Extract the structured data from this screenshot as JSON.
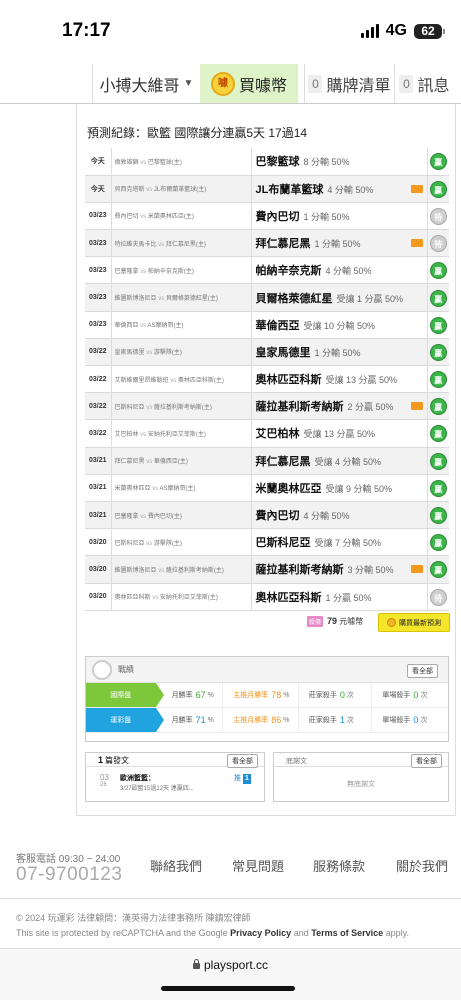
{
  "status_bar": {
    "time": "17:17",
    "network": "4G",
    "battery": "62"
  },
  "nav": {
    "user": "小搏大維哥",
    "buy_coin_icon": "coin-icon",
    "buy_label": "買噱幣",
    "list_count": "0",
    "list_label": "購牌清單",
    "msg_count": "0",
    "msg_label": "訊息"
  },
  "prediction": {
    "title": "預測紀錄：歐籃  國際讓分連贏5天 17過14",
    "rows": [
      {
        "date": "今天",
        "home": "倫敦雄獅",
        "away": "巴黎籃球",
        "team": "巴黎籃球",
        "detail": "8 分輸 50%",
        "star": false,
        "status": "贏"
      },
      {
        "date": "今天",
        "home": "貝西克塔斯",
        "away": "JL布爾蘭革籃球",
        "team": "JL布蘭革籃球",
        "detail": "4 分輸 50%",
        "star": true,
        "status": "贏"
      },
      {
        "date": "03/23",
        "home": "費內巴切",
        "away": "米蘭奧林匹亞",
        "team": "費內巴切",
        "detail": "1 分輸 50%",
        "star": false,
        "status": "待"
      },
      {
        "date": "03/23",
        "home": "特拉維夫馬卡比",
        "away": "拜仁慕尼黑",
        "team": "拜仁慕尼黑",
        "detail": "1 分輸 50%",
        "star": true,
        "status": "待"
      },
      {
        "date": "03/23",
        "home": "巴塞隆拿",
        "away": "帕納辛奈克斯",
        "team": "帕納辛奈克斯",
        "detail": "4 分輸 50%",
        "star": false,
        "status": "贏"
      },
      {
        "date": "03/23",
        "home": "維圖斯博洛尼亞",
        "away": "貝爾格萊德紅星",
        "team": "貝爾格萊德紅星",
        "detail": "受讓 1 分贏 50%",
        "star": false,
        "status": "贏"
      },
      {
        "date": "03/23",
        "home": "華倫西亞",
        "away": "AS摩納哥",
        "team": "華倫西亞",
        "detail": "受讓 10 分輸 50%",
        "star": false,
        "status": "贏"
      },
      {
        "date": "03/22",
        "home": "皇家馬德里",
        "away": "游擊隊",
        "team": "皇家馬德里",
        "detail": "1 分輸 50%",
        "star": false,
        "status": "贏"
      },
      {
        "date": "03/22",
        "home": "艾斯維爾里昂維勒班",
        "away": "奧林匹亞科斯",
        "team": "奧林匹亞科斯",
        "detail": "受讓 13 分贏 50%",
        "star": false,
        "status": "贏"
      },
      {
        "date": "03/22",
        "home": "巴斯科尼亞",
        "away": "薩拉基利斯考納斯",
        "team": "薩拉基利斯考納斯",
        "detail": "2 分贏 50%",
        "star": true,
        "status": "贏"
      },
      {
        "date": "03/22",
        "home": "艾巴柏林",
        "away": "安納托利亞艾菲斯",
        "team": "艾巴柏林",
        "detail": "受讓 13 分贏 50%",
        "star": false,
        "status": "贏"
      },
      {
        "date": "03/21",
        "home": "拜仁慕尼黑",
        "away": "華倫西亞",
        "team": "拜仁慕尼黑",
        "detail": "受讓 4 分輸 50%",
        "star": false,
        "status": "贏"
      },
      {
        "date": "03/21",
        "home": "米蘭奧林匹亞",
        "away": "AS摩納哥",
        "team": "米蘭奧林匹亞",
        "detail": "受讓 9 分輸 50%",
        "star": false,
        "status": "贏"
      },
      {
        "date": "03/21",
        "home": "巴塞隆拿",
        "away": "費內巴切",
        "team": "費內巴切",
        "detail": "4 分輸 50%",
        "star": false,
        "status": "贏"
      },
      {
        "date": "03/20",
        "home": "巴斯科尼亞",
        "away": "游擊隊",
        "team": "巴斯科尼亞",
        "detail": "受讓 7 分輸 50%",
        "star": false,
        "status": "贏"
      },
      {
        "date": "03/20",
        "home": "維圖斯博洛尼亞",
        "away": "薩拉基利斯考納斯",
        "team": "薩拉基利斯考納斯",
        "detail": "3 分輸 50%",
        "star": true,
        "status": "贏"
      },
      {
        "date": "03/20",
        "home": "奧林匹亞科斯",
        "away": "安納托利亞艾菲斯",
        "team": "奧林匹亞科斯",
        "detail": "1 分贏 50%",
        "star": false,
        "status": "待"
      }
    ],
    "vs_text": "vs",
    "home_suffix": "(主)",
    "price_tag": "殺價",
    "price_value": "79",
    "price_unit": "元噱幣",
    "buy_button": "購買最新預測"
  },
  "record": {
    "title": "戰績",
    "view_all": "看全部",
    "rows": [
      {
        "label": "國際盤",
        "color": "#7dc73b",
        "rate_label": "月勝率",
        "rate": "67",
        "main_label": "主推月勝率",
        "main_rate": "78",
        "killer_label": "莊家殺手",
        "killer": "0",
        "single_label": "單場殺手",
        "single": "0",
        "unit_pct": "%",
        "unit_count": "次"
      },
      {
        "label": "運彩盤",
        "color": "#21a3e0",
        "rate_label": "月勝率",
        "rate": "71",
        "main_label": "主推月勝率",
        "main_rate": "86",
        "killer_label": "莊家殺手",
        "killer": "1",
        "single_label": "單場殺手",
        "single": "0",
        "unit_pct": "%",
        "unit_count": "次"
      }
    ]
  },
  "posts": {
    "count": "1",
    "label": "篇發文",
    "view_all": "看全部",
    "items": [
      {
        "month": "03",
        "day": "26",
        "title": "歐洲籃籃：",
        "sub": "3/27歐籃15過12天 連贏四...",
        "push_label": "推",
        "push_count": "1"
      }
    ]
  },
  "ask": {
    "label": "底謝文",
    "view_all": "看全部",
    "empty": "無底謝文"
  },
  "footer": {
    "service_label": "客服電話 09:30 ~ 24:00",
    "service_phone": "07-9700123",
    "links": [
      "聯絡我們",
      "常見問題",
      "服務條款",
      "關於我們"
    ],
    "copyright": "© 2024 玩運彩  法律顧問：漢英得力法律事務所 陳鎮宏律師",
    "recaptcha_prefix": "This site is protected by reCAPTCHA and the Google",
    "privacy": "Privacy Policy",
    "and": "and",
    "terms": "Terms of Service",
    "apply": "apply."
  },
  "browser": {
    "url": "playsport.cc"
  },
  "colors": {
    "win": "#3bb44a",
    "pending": "#cfcfcf",
    "buy_button": "#f6e62b",
    "nav_active": "#dff3c8"
  }
}
